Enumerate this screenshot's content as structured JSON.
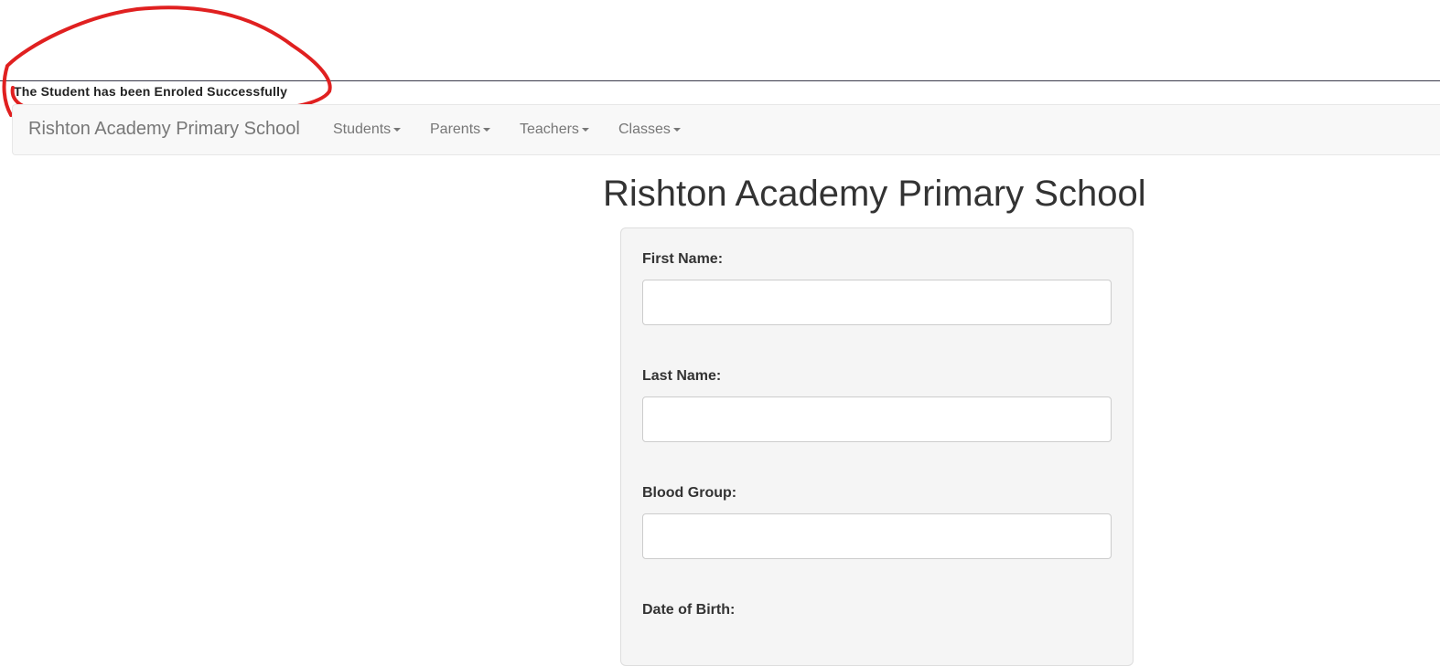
{
  "notice": {
    "message": "The Student has been Enroled Successfully"
  },
  "navbar": {
    "brand": "Rishton Academy Primary School",
    "items": [
      {
        "label": "Students"
      },
      {
        "label": "Parents"
      },
      {
        "label": "Teachers"
      },
      {
        "label": "Classes"
      }
    ]
  },
  "main": {
    "title": "Rishton Academy Primary School",
    "form": {
      "fields": [
        {
          "label": "First Name:",
          "value": ""
        },
        {
          "label": "Last Name:",
          "value": ""
        },
        {
          "label": "Blood Group:",
          "value": ""
        },
        {
          "label": "Date of Birth:"
        }
      ]
    }
  },
  "colors": {
    "annotation_stroke": "#e02020",
    "navbar_bg": "#f8f8f8",
    "form_bg": "#f5f5f5"
  }
}
